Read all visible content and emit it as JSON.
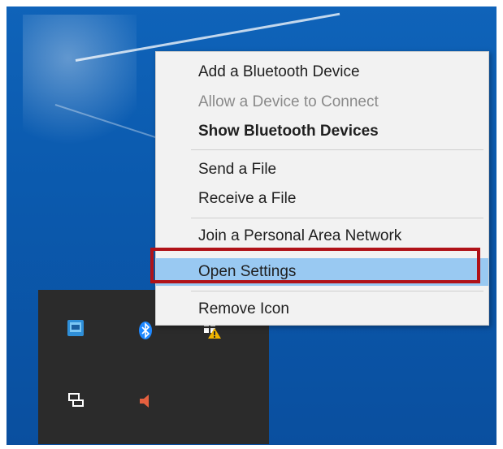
{
  "context_menu": {
    "items": [
      {
        "label": "Add a Bluetooth Device",
        "state": "enabled"
      },
      {
        "label": "Allow a Device to Connect",
        "state": "disabled"
      },
      {
        "label": "Show Bluetooth Devices",
        "state": "default"
      },
      {
        "label": "Send a File",
        "state": "enabled"
      },
      {
        "label": "Receive a File",
        "state": "enabled"
      },
      {
        "label": "Join a Personal Area Network",
        "state": "enabled"
      },
      {
        "label": "Open Settings",
        "state": "highlighted"
      },
      {
        "label": "Remove Icon",
        "state": "enabled"
      }
    ]
  },
  "tray": {
    "icons": [
      {
        "name": "intel-graphics-icon"
      },
      {
        "name": "bluetooth-icon"
      },
      {
        "name": "security-warning-icon"
      },
      {
        "name": "display-switch-icon"
      },
      {
        "name": "speaker-icon"
      }
    ]
  },
  "colors": {
    "desktop_blue": "#0b5aae",
    "menu_bg": "#f2f2f2",
    "highlight": "#99c9f2",
    "annotation_red": "#b01218",
    "bluetooth_blue": "#1e88ff"
  }
}
